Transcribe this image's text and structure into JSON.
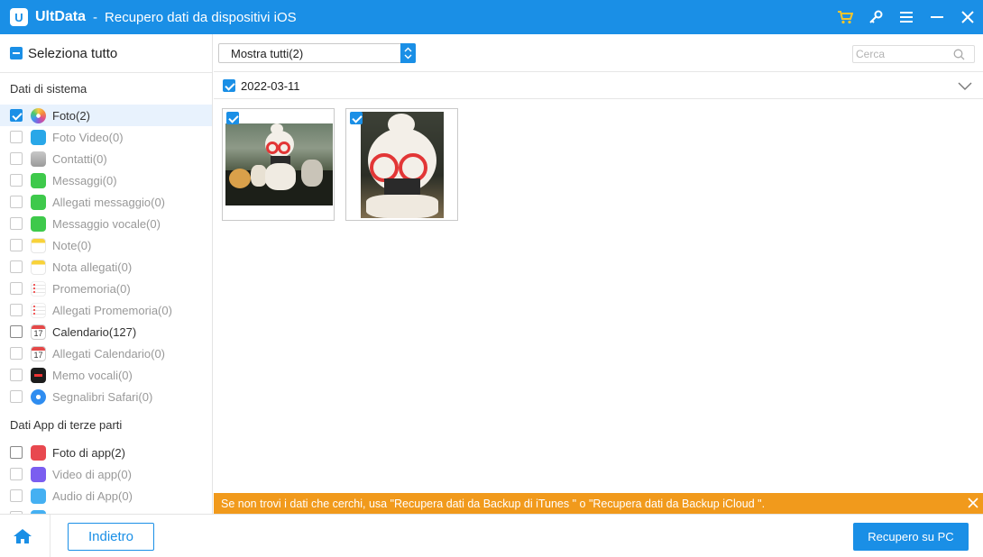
{
  "titlebar": {
    "app_name": "UltData",
    "separator": "-",
    "title": "Recupero dati da dispositivi iOS",
    "icons": [
      "cart-icon",
      "key-icon",
      "menu-icon",
      "minimize-icon",
      "close-icon"
    ],
    "icon_color": "#f5c52b"
  },
  "left": {
    "select_all": "Seleziona tutto",
    "system_section": "Dati di sistema",
    "system_items": [
      {
        "label": "Foto(2)",
        "icon": "photos-icon",
        "checked": true
      },
      {
        "label": "Foto Video(0)",
        "icon": "video-icon"
      },
      {
        "label": "Contatti(0)",
        "icon": "contacts-icon"
      },
      {
        "label": "Messaggi(0)",
        "icon": "messages-icon"
      },
      {
        "label": "Allegati messaggio(0)",
        "icon": "messages-icon"
      },
      {
        "label": "Messaggio vocale(0)",
        "icon": "voicemail-icon"
      },
      {
        "label": "Note(0)",
        "icon": "notes-icon"
      },
      {
        "label": "Nota allegati(0)",
        "icon": "notes-icon"
      },
      {
        "label": "Promemoria(0)",
        "icon": "reminders-icon"
      },
      {
        "label": "Allegati Promemoria(0)",
        "icon": "reminders-icon"
      },
      {
        "label": "Calendario(127)",
        "icon": "calendar-icon"
      },
      {
        "label": "Allegati Calendario(0)",
        "icon": "calendar-icon"
      },
      {
        "label": "Memo vocali(0)",
        "icon": "voice-memo-icon"
      },
      {
        "label": "Segnalibri Safari(0)",
        "icon": "safari-icon"
      }
    ],
    "calendar_day": "17",
    "app_section": "Dati App di terze parti",
    "app_items": [
      {
        "label": "Foto di app(2)",
        "icon": "app-photos-icon"
      },
      {
        "label": "Video di app(0)",
        "icon": "app-video-icon"
      },
      {
        "label": "Audio di App(0)",
        "icon": "app-audio-icon"
      }
    ]
  },
  "toolbar": {
    "filter_value": "Mostra tutti(2)",
    "search_placeholder": "Cerca"
  },
  "content": {
    "date": "2022-03-11",
    "thumbnails": 2
  },
  "banner": {
    "text": "Se non trovi i dati che cerchi, usa \"Recupera dati da Backup di iTunes \" o \"Recupera dati da Backup iCloud \"."
  },
  "footer": {
    "back_label": "Indietro",
    "recover_label": "Recupero su PC"
  },
  "colors": {
    "accent": "#1a8fe6",
    "banner": "#f19a1c"
  }
}
